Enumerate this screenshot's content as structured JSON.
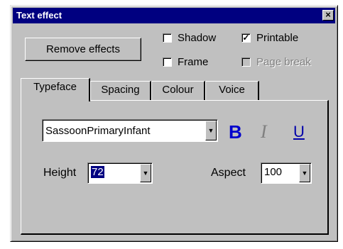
{
  "window": {
    "title": "Text effect"
  },
  "buttons": {
    "remove_effects": "Remove effects"
  },
  "checkboxes": {
    "shadow": {
      "label": "Shadow",
      "checked": false
    },
    "printable": {
      "label": "Printable",
      "checked": true
    },
    "frame": {
      "label": "Frame",
      "checked": false
    },
    "page_break": {
      "label": "Page break",
      "checked": false,
      "disabled": true
    }
  },
  "tabs": [
    {
      "label": "Typeface",
      "active": true
    },
    {
      "label": "Spacing",
      "active": false
    },
    {
      "label": "Colour",
      "active": false
    },
    {
      "label": "Voice",
      "active": false
    }
  ],
  "typeface": {
    "font_value": "SassoonPrimaryInfant",
    "bold_glyph": "B",
    "italic_glyph": "I",
    "underline_glyph": "U",
    "height_label": "Height",
    "height_value": "72",
    "aspect_label": "Aspect",
    "aspect_value": "100"
  },
  "colors": {
    "title_bar": "#000080",
    "face": "#c0c0c0",
    "bold_active": "#0000cc"
  }
}
